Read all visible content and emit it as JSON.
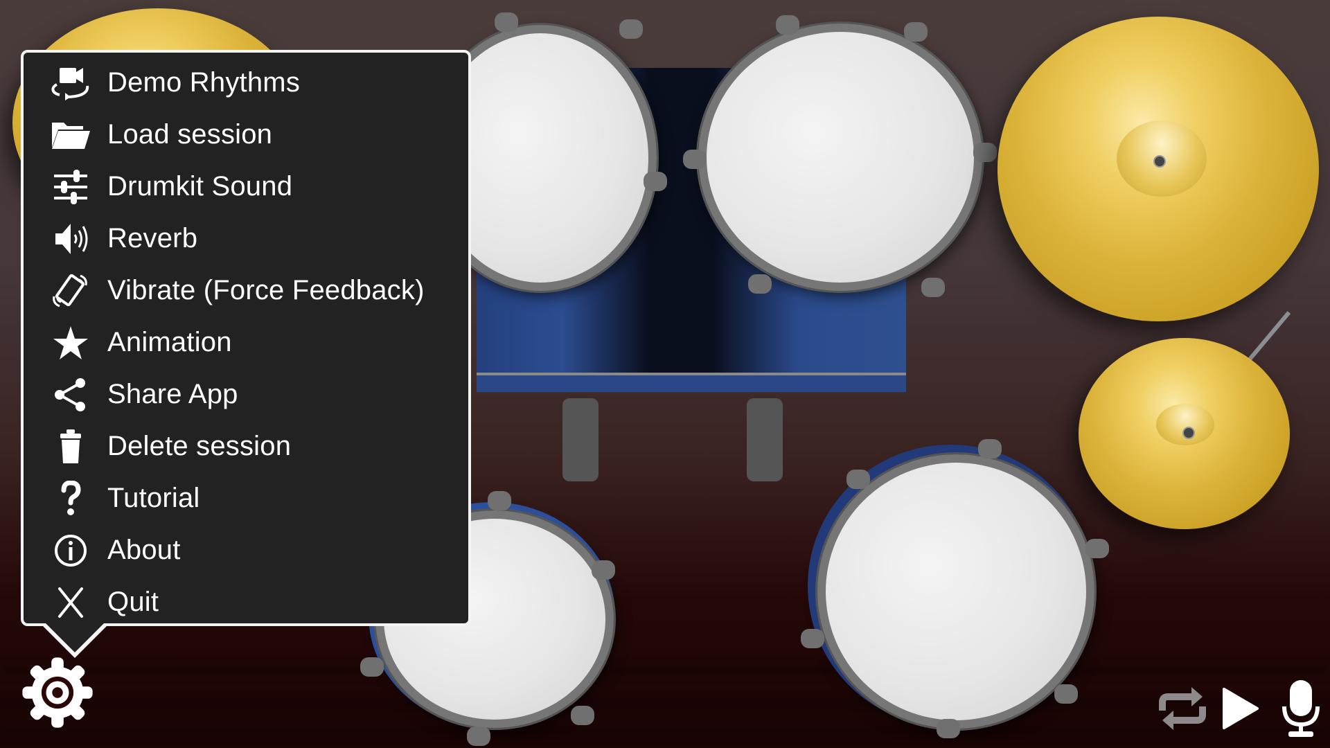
{
  "app": {
    "name": "Drum kit",
    "accent_color": "#ffffff",
    "menu_background": "#222222"
  },
  "menu": {
    "items": [
      {
        "label": "Demo Rhythms",
        "icon": "video-rotate-icon"
      },
      {
        "label": "Load session",
        "icon": "folder-open-icon"
      },
      {
        "label": "Drumkit Sound",
        "icon": "sliders-icon"
      },
      {
        "label": "Reverb",
        "icon": "speaker-icon"
      },
      {
        "label": "Vibrate (Force Feedback)",
        "icon": "vibrate-icon"
      },
      {
        "label": "Animation",
        "icon": "star-icon"
      },
      {
        "label": "Share App",
        "icon": "share-icon"
      },
      {
        "label": "Delete session",
        "icon": "trash-icon"
      },
      {
        "label": "Tutorial",
        "icon": "question-icon"
      },
      {
        "label": "About",
        "icon": "info-icon"
      },
      {
        "label": "Quit",
        "icon": "close-icon"
      }
    ]
  },
  "controls": {
    "settings": {
      "icon": "gear-icon"
    },
    "loop": {
      "icon": "repeat-icon",
      "enabled": false
    },
    "play": {
      "icon": "play-icon"
    },
    "record": {
      "icon": "microphone-icon"
    }
  },
  "kit": {
    "pieces": [
      "crash-cymbal-left",
      "tom-1",
      "tom-2",
      "bass-drum",
      "crash-cymbal-right",
      "hihat-cymbal",
      "snare-drum",
      "floor-tom"
    ]
  }
}
